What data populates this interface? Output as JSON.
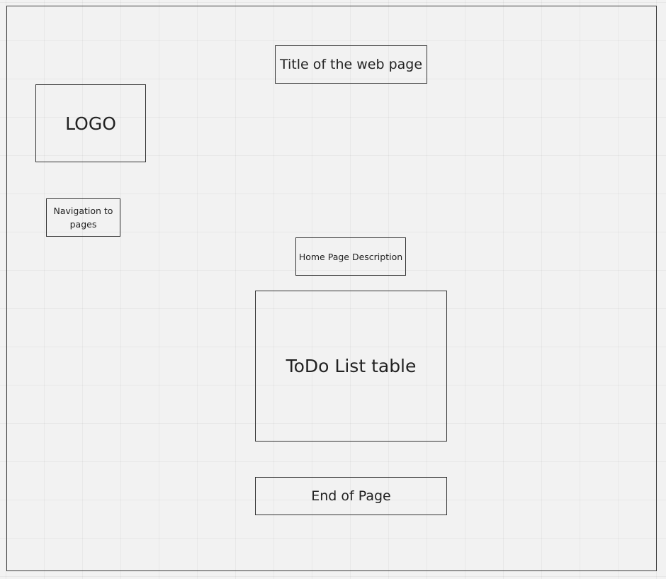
{
  "wireframe": {
    "title_box": {
      "label": "Title of the web page"
    },
    "logo_box": {
      "label": "LOGO"
    },
    "nav_box": {
      "label": "Navigation to pages"
    },
    "description_box": {
      "label": "Home Page Description"
    },
    "todo_box": {
      "label": "ToDo List table"
    },
    "end_box": {
      "label": "End of Page"
    }
  },
  "colors": {
    "background": "#f2f2f2",
    "border": "#333333",
    "text": "#222222"
  }
}
